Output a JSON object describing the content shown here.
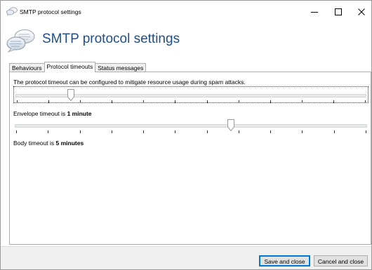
{
  "window": {
    "title": "SMTP protocol settings",
    "controls": {
      "minimize": "–",
      "maximize": "☐",
      "close": "✕"
    }
  },
  "header": {
    "title": "SMTP protocol settings",
    "icon": "speech-bubbles-icon"
  },
  "tabs": [
    {
      "label": "Behaviours",
      "active": false
    },
    {
      "label": "Protocol timeouts",
      "active": true
    },
    {
      "label": "Status messages",
      "active": false
    }
  ],
  "panel": {
    "description": "The protocol timeout can be configured to mitigate resource usage during spam attacks.",
    "envelope": {
      "label_prefix": "Envelope timeout is",
      "value": "1 minute",
      "slider_position": 0.155,
      "tick_count": 12
    },
    "body": {
      "label_prefix": "Body timeout is",
      "value": "5 minutes",
      "slider_position": 0.615,
      "tick_count": 12
    }
  },
  "footer": {
    "save_label": "Save and close",
    "cancel_label": "Cancel and close"
  },
  "colors": {
    "header_title": "#1e4e8c",
    "primary_button_border": "#0078d7"
  }
}
